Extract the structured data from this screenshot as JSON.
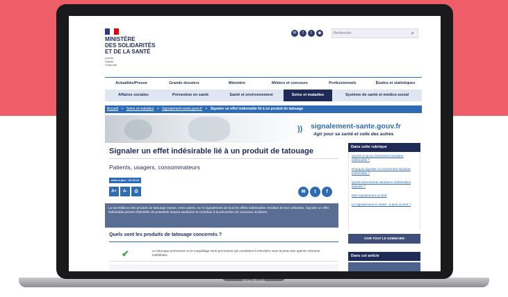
{
  "brand_label": "MacBook",
  "header": {
    "ministry_name": [
      "MINISTÈRE",
      "DES SOLIDARITÉS",
      "ET DE LA SANTÉ"
    ],
    "motto": [
      "Liberté",
      "Égalité",
      "Fraternité"
    ],
    "social_icons": [
      "mail-icon",
      "facebook-icon",
      "twitter-icon",
      "rss-icon"
    ],
    "search_placeholder": "Rechercher"
  },
  "nav_primary": [
    "Actualités/Presse",
    "Grands dossiers",
    "Ministère",
    "Métiers et concours",
    "Professionnels",
    "Études et statistiques"
  ],
  "nav_secondary": [
    {
      "label": "Affaires sociales",
      "active": false
    },
    {
      "label": "Prévention en santé",
      "active": false
    },
    {
      "label": "Santé et environnement",
      "active": false
    },
    {
      "label": "Soins et maladies",
      "active": true
    },
    {
      "label": "Système de santé et médico-social",
      "active": false
    }
  ],
  "breadcrumb": [
    "Accueil",
    ">",
    "Soins et maladies",
    ">",
    "Signalement-sante.gouv.fr",
    ">",
    "Signaler un effet indésirable lié à un produit de tatouage"
  ],
  "banner": {
    "url": "signalement-sante.gouv.fr",
    "tagline": "Agir pour sa santé et celle des autres"
  },
  "page": {
    "title": "Signaler un effet indésirable lié à un produit de tatouage",
    "subtitle": "Patients, usagers, consommateurs",
    "updated": "mise à jour : 19.10.19",
    "tools": [
      "A+",
      "A-",
      "print-icon"
    ],
    "share": [
      "mail-icon",
      "twitter-icon",
      "facebook-icon"
    ],
    "intro": "La surveillance des produits de tatouage repose, entre autres, sur le signalement de tous les effets indésirables résultant de leur utilisation. Signaler un effet indésirable permet d'identifier de potentiels risques sanitaires et contribue à la prévention de nouveaux incidents.",
    "question": "Quels sont les produits de tatouage concernés ?",
    "row_text": "Le tatouage permanent ou le maquillage semi-permanent qui consistent à introduire sous la peau des agents colorants indélébiles."
  },
  "sidebar": {
    "heading": "Dans cette rubrique",
    "links": [
      "Qu'est-ce qu'un évènement sanitaire indésirable ?",
      "Pourquoi signaler un évènement sanitaire indésirable ?",
      "Quels évènements sanitaires indésirables signaler ?",
      "Mon signalement en bref",
      "Le signalement en santé : à quoi ça sert ?"
    ],
    "summary_button": "VOIR TOUT LE SOMMAIRE",
    "heading2": "Dans cet article"
  },
  "colors": {
    "background_band": "#ee5e69",
    "navy": "#1f2b57",
    "blue": "#2d6cb4",
    "check": "#3ea74a"
  }
}
